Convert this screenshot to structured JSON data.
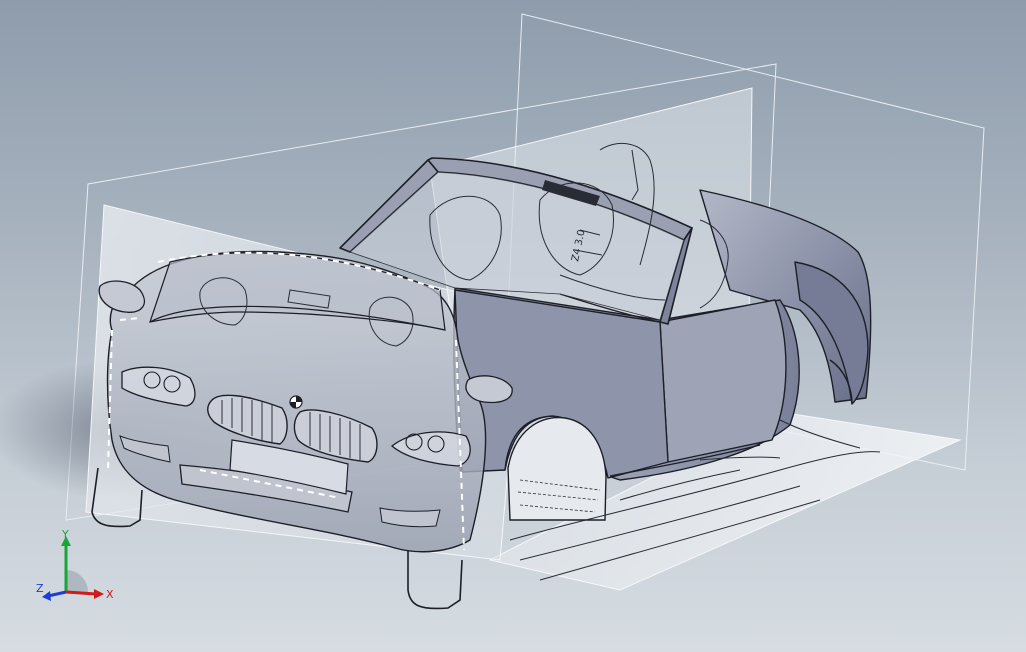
{
  "viewport": {
    "background_top": "#8e9cac",
    "background_bottom": "#d6dce2"
  },
  "model": {
    "body_color": "#8a90a6",
    "body_light": "#a7adbf",
    "body_dark": "#6f7590",
    "edge_color": "#1d1f28",
    "sketch_color": "#2a2c35",
    "plane_color": "#e8ecf1",
    "plane_edge": "#f4f6f8",
    "badge_text": "Z4 3.0"
  },
  "triad": {
    "x_label": "X",
    "y_label": "Y",
    "z_label": "Z",
    "x_color": "#d11a1a",
    "y_color": "#18a63a",
    "z_color": "#1b3fd1"
  }
}
